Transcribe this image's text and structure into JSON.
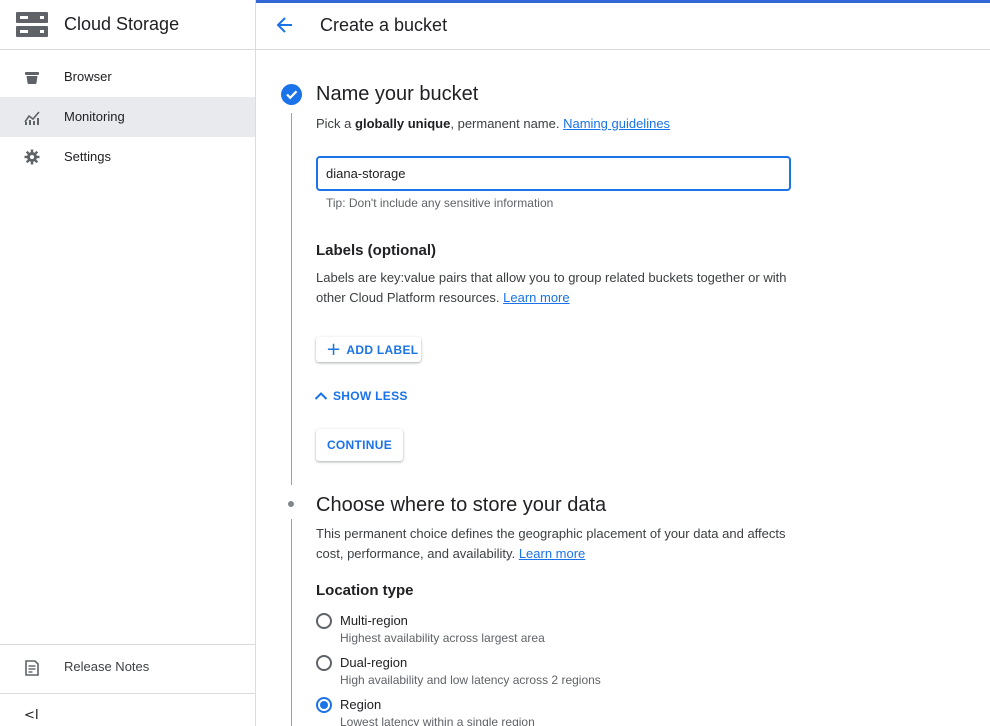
{
  "app": {
    "title": "Cloud Storage",
    "accent_color": "#1a73e8"
  },
  "sidebar": {
    "items": [
      {
        "label": "Browser",
        "icon": "bucket-icon"
      },
      {
        "label": "Monitoring",
        "icon": "monitoring-icon",
        "active": true
      },
      {
        "label": "Settings",
        "icon": "gear-icon"
      }
    ],
    "release_notes": "Release Notes",
    "collapse_label": "<I"
  },
  "header": {
    "title": "Create a bucket",
    "back_icon": "arrow-back-icon"
  },
  "step1": {
    "title": "Name your bucket",
    "desc_pre": "Pick a ",
    "desc_bold": "globally unique",
    "desc_post": ", permanent name. ",
    "guidelines_link": "Naming guidelines",
    "input_value": "diana-storage",
    "tip": "Tip: Don't include any sensitive information",
    "labels_heading": "Labels (optional)",
    "labels_desc_1": "Labels are key:value pairs that allow you to group related buckets together or with",
    "labels_desc_2": "other Cloud Platform resources. ",
    "labels_learn_more": "Learn more",
    "add_label_button": "ADD LABEL",
    "show_less_button": "SHOW LESS",
    "continue_button": "CONTINUE"
  },
  "step2": {
    "title": "Choose where to store your data",
    "desc_1": "This permanent choice defines the geographic placement of your data and affects",
    "desc_2": "cost, performance, and availability. ",
    "learn_more": "Learn more",
    "location_type_heading": "Location type",
    "options": [
      {
        "label": "Multi-region",
        "sub": "Highest availability across largest area",
        "checked": false
      },
      {
        "label": "Dual-region",
        "sub": "High availability and low latency across 2 regions",
        "checked": false
      },
      {
        "label": "Region",
        "sub": "Lowest latency within a single region",
        "checked": true
      }
    ]
  }
}
